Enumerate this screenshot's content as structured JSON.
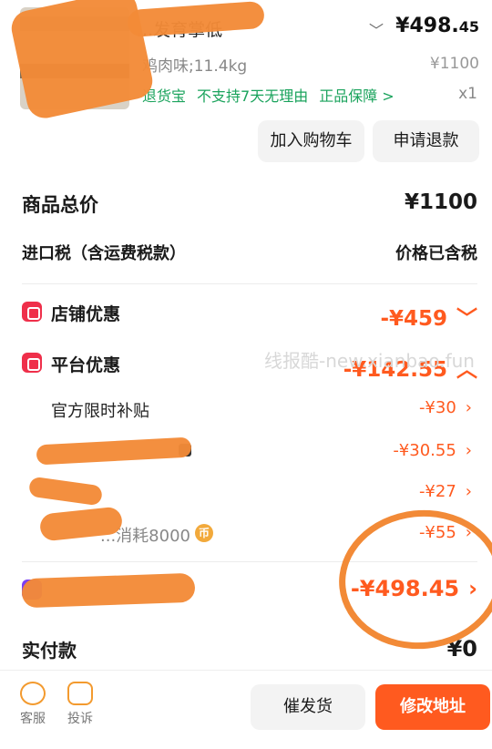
{
  "product": {
    "title_visible": "...发育掌低",
    "price_main": "¥498.",
    "price_cents": "45",
    "spec": "鸡肉味;11.4kg",
    "original_price": "¥1100",
    "tags": [
      "退货宝",
      "不支持7天无理由",
      "正品保障 >"
    ],
    "quantity": "x1",
    "add_to_cart": "加入购物车",
    "refund": "申请退款"
  },
  "summary": {
    "total_label": "商品总价",
    "total_value": "¥1100",
    "tax_label": "进口税（含运费税款）",
    "tax_value": "价格已含税",
    "shop_discount_label": "店铺优惠",
    "shop_discount_value": "-¥459",
    "platform_discount_label": "平台优惠",
    "platform_discount_value": "-¥142.55",
    "sub_items": [
      {
        "label": "官方限时补贴",
        "value": "-¥30"
      },
      {
        "label": "",
        "value": "-¥30.55"
      },
      {
        "label": "",
        "value": "-¥27"
      },
      {
        "label": "...消耗8000",
        "value": "-¥55"
      }
    ],
    "grand_total_value": "-¥498.45",
    "paid_label": "实付款",
    "paid_value": "¥0"
  },
  "bottom": {
    "customer_service": "客服",
    "complaint": "投诉",
    "urge_shipping": "催发货",
    "change_address": "修改地址"
  },
  "watermark": "线报酷-new.xianbao.fun",
  "colors": {
    "accent": "#ff5a1f",
    "green": "#1aa35c",
    "scribble": "#f28a37"
  }
}
